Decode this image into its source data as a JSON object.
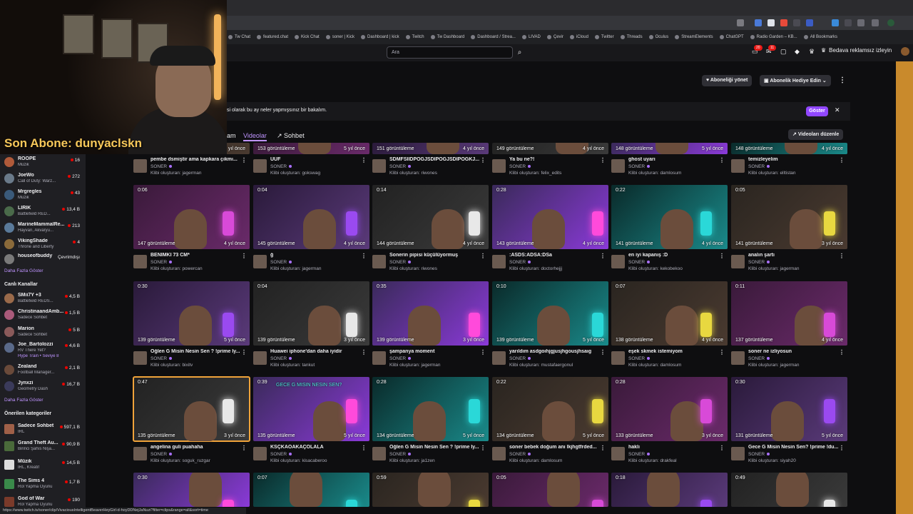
{
  "browser": {
    "bookmarks": [
      "Tw Chat",
      "featured.chat",
      "Kick Chat",
      "soner | Kick",
      "Dashboard | kick",
      "Twitch",
      "Tw Dashboard",
      "Dashboard / Strea...",
      "LIVAD",
      "Çevir",
      "iCloud",
      "Twitter",
      "Threads",
      "Oculus",
      "StreamElements",
      "ChatGPT",
      "Radio Garden – KB...",
      "All Bookmarks"
    ],
    "status_url": "https://www.twitch.tv/soner/clip/VivaciousIntelligentBeaverHeyGirl-d-hoyDDNejJaNuzi?filter=clips&range=all&sort=time"
  },
  "header": {
    "search_placeholder": "Ara",
    "notif_badge_1": "20",
    "notif_badge_2": "11",
    "ad_free": "Bedava reklamsız izleyin"
  },
  "overlay": {
    "last_sub": "Son Abone: dunyaclskn"
  },
  "sidebar": {
    "followed": [
      {
        "name": "ROOPE",
        "game": "Müzik",
        "viewers": "16",
        "color": "#b05a3a"
      },
      {
        "name": "JoeWo",
        "game": "Call of Duty: Warz...",
        "viewers": "272",
        "color": "#6a7a8a"
      },
      {
        "name": "Mrgregles",
        "game": "Müzik",
        "viewers": "43",
        "color": "#3a5a7a"
      },
      {
        "name": "LIRIK",
        "game": "Battlefield RED...",
        "viewers": "13,4 B",
        "color": "#4a6a4a"
      },
      {
        "name": "MarineMammalRe...",
        "game": "Hayvan, Akvaryu...",
        "viewers": "213",
        "color": "#5a7a9a"
      },
      {
        "name": "VikingShade",
        "game": "Throne and Liberty",
        "viewers": "4",
        "color": "#8a6a3a"
      },
      {
        "name": "houseofbuddy",
        "game": "",
        "viewers": "",
        "offline": "Çevrimdışı",
        "color": "#7a7a7a"
      }
    ],
    "more_1": "Daha Fazla Göster",
    "live_title": "Canlı Kanallar",
    "live": [
      {
        "name": "SMii7Y +3",
        "game": "Battlefield REDS...",
        "viewers": "4,5 B",
        "color": "#9a6a4a"
      },
      {
        "name": "ChristinaandAmb...",
        "game": "Sadece Sohbet",
        "viewers": "1,5 B",
        "color": "#aa5a7a"
      },
      {
        "name": "Marion",
        "game": "Sadece Sohbet",
        "viewers": "5 B",
        "color": "#8a5a5a"
      },
      {
        "name": "Joe_Bartolozzi",
        "game": "RV There Yet?",
        "extra": "Hype Train • Seviye 8",
        "viewers": "4,6 B",
        "color": "#5a6a8a"
      },
      {
        "name": "Zealand",
        "game": "Football Manager...",
        "viewers": "2,1 B",
        "color": "#6a4a3a"
      },
      {
        "name": "Jynxzi",
        "game": "Geometry Dash",
        "viewers": "16,7 B",
        "color": "#3a3a5a"
      }
    ],
    "more_2": "Daha Fazla Göster",
    "cat_title": "Önerilen kategoriler",
    "categories": [
      {
        "name": "Sadece Sohbet",
        "game": "IRL",
        "viewers": "597,1 B",
        "color": "#a06048"
      },
      {
        "name": "Grand Theft Au...",
        "game": "Birinci Şahıs Nişa...",
        "viewers": "90,9 B",
        "color": "#4a6a3a"
      },
      {
        "name": "Müzik",
        "game": "IRL, Kreatif",
        "viewers": "14,5 B",
        "color": "#ddd"
      },
      {
        "name": "The Sims 4",
        "game": "Rol Yapma Oyunu",
        "viewers": "1,7 B",
        "color": "#3a8a4a"
      },
      {
        "name": "God of War",
        "game": "Rol Yapma Oyunu",
        "viewers": "190",
        "color": "#7a3a2a"
      }
    ]
  },
  "page": {
    "manage_sub": "Aboneliği yönet",
    "gift_sub": "Abonelik Hediye Edin",
    "banner_text": "si olarak bu ay neler yapmışsınız bir bakalım.",
    "show_button": "Göster",
    "tabs": {
      "partial": "am",
      "videos": "Videolar",
      "chat": "Sohbet"
    },
    "edit_videos": "Videoları düzenle"
  },
  "clips_row0": [
    {
      "views": "",
      "age": "5 yıl önce",
      "title": "pembe dsmiştir ama kapkara çıkmı...",
      "owner": "SONER",
      "creator": "Klibi oluşturan: jagerman"
    },
    {
      "views": "153 görüntüleme",
      "age": "5 yıl önce",
      "title": "ÜÜF",
      "owner": "SONER",
      "creator": "Klibi oluşturan: gokswag"
    },
    {
      "views": "151 görüntüleme",
      "age": "4 yıl önce",
      "title": "SDMFSIIDPOGJSDIPOGJSDIPOGKJ...",
      "owner": "SONER",
      "creator": "Klibi oluşturan: riwones"
    },
    {
      "views": "149 görüntüleme",
      "age": "4 yıl önce",
      "title": "Ya bu ne?!",
      "owner": "SONER",
      "creator": "Klibi oluşturan: felix_edits"
    },
    {
      "views": "148 görüntüleme",
      "age": "5 yıl önce",
      "title": "ghost uyarı",
      "owner": "SONER",
      "creator": "Klibi oluşturan: damlosum"
    },
    {
      "views": "148 görüntüleme",
      "age": "4 yıl önce",
      "title": "temizleyelim",
      "owner": "SONER",
      "creator": "Klibi oluşturan: elltistan"
    }
  ],
  "clips_row1": [
    {
      "dur": "0:06",
      "views": "147 görüntüleme",
      "age": "4 yıl önce",
      "title": "BENİMKİ 73 CM*",
      "owner": "SONER",
      "creator": "Klibi oluşturan: powercan"
    },
    {
      "dur": "0:04",
      "views": "145 görüntüleme",
      "age": "4 yıl önce",
      "title": "ğ",
      "owner": "SONER",
      "creator": "Klibi oluşturan: jagerman"
    },
    {
      "dur": "0:14",
      "views": "144 görüntüleme",
      "age": "4 yıl önce",
      "title": "Sonerin pipisi küçülüyormuş",
      "owner": "SONER",
      "creator": "Klibi oluşturan: riwones"
    },
    {
      "dur": "0:28",
      "views": "143 görüntüleme",
      "age": "4 yıl önce",
      "title": ":ASDS:ADSA:DSa",
      "owner": "SONER",
      "creator": "Klibi oluşturan: doctorhejjj"
    },
    {
      "dur": "0:22",
      "views": "141 görüntüleme",
      "age": "4 yıl önce",
      "title": "en iyi kapanış :D",
      "owner": "SONER",
      "creator": "Klibi oluşturan: kekobekoo"
    },
    {
      "dur": "0:05",
      "views": "141 görüntüleme",
      "age": "3 yıl önce",
      "title": "analın şartı",
      "owner": "SONER",
      "creator": "Klibi oluşturan: jagerman"
    }
  ],
  "clips_row2": [
    {
      "dur": "0:30",
      "views": "139 görüntüleme",
      "age": "5 yıl önce",
      "title": "Öğlen G Misin Nesin Sen ? !prime İy...",
      "owner": "SONER",
      "creator": "Klibi oluşturan: bixitv"
    },
    {
      "dur": "0:04",
      "views": "139 görüntüleme",
      "age": "3 yıl önce",
      "title": "Huawei iphone'dan daha iyidir",
      "owner": "SONER",
      "creator": "Klibi oluşturan: tankut"
    },
    {
      "dur": "0:35",
      "views": "139 görüntüleme",
      "age": "3 yıl önce",
      "title": "şampanya moment",
      "owner": "SONER",
      "creator": "Klibi oluşturan: jagerman"
    },
    {
      "dur": "0:10",
      "views": "139 görüntüleme",
      "age": "5 yıl önce",
      "title": "yarıldım asdgoıhjgjusjhgousjhsaıg",
      "owner": "SONER",
      "creator": "Klibi oluşturan: mustafaergonul"
    },
    {
      "dur": "0:07",
      "views": "138 görüntüleme",
      "age": "4 yıl önce",
      "title": "eşek skmek istemiyom",
      "owner": "SONER",
      "creator": "Klibi oluşturan: damlosum"
    },
    {
      "dur": "0:11",
      "views": "137 görüntüleme",
      "age": "4 yıl önce",
      "title": "soner ne izliyosun",
      "owner": "SONER",
      "creator": "Klibi oluşturan: jagerman"
    }
  ],
  "clips_row3": [
    {
      "dur": "0:47",
      "views": "135 görüntüleme",
      "age": "3 yıl önce",
      "title": "angelina guli puahaha",
      "owner": "SONER",
      "creator": "Klibi oluşturan: soguk_ruzgar"
    },
    {
      "dur": "0:39",
      "views": "135 görüntüleme",
      "age": "5 yıl önce",
      "title": "KSÇKAÖAKAÇÖLALA",
      "owner": "SONER",
      "creator": "Klibi oluşturan: kisacaberoo",
      "overlay": "GECE G MISIN NESIN SEN?"
    },
    {
      "dur": "0:28",
      "views": "134 görüntüleme",
      "age": "5 yıl önce",
      "title": "Öğlen G Misin Nesin Sen ? !prime İy...",
      "owner": "SONER",
      "creator": "Klibi oluşturan: ja1zen"
    },
    {
      "dur": "0:22",
      "views": "134 görüntüleme",
      "age": "5 yıl önce",
      "title": "soner bebek doğum anı lkjhgtfrded...",
      "owner": "SONER",
      "creator": "Klibi oluşturan: damlosum"
    },
    {
      "dur": "0:28",
      "views": "133 görüntüleme",
      "age": "3 yıl önce",
      "title": "haklı",
      "owner": "SONER",
      "creator": "Klibi oluşturan: drakfeal"
    },
    {
      "dur": "0:30",
      "views": "131 görüntüleme",
      "age": "5 yıl önce",
      "title": "Gece G Misin Nesin Sen? !prime !du...",
      "owner": "SONER",
      "creator": "Klibi oluşturan: siyah20"
    }
  ],
  "clips_row4": [
    {
      "dur": "0:30"
    },
    {
      "dur": "0:07"
    },
    {
      "dur": "0:59"
    },
    {
      "dur": "0:05"
    },
    {
      "dur": "0:18"
    },
    {
      "dur": "0:49"
    }
  ]
}
